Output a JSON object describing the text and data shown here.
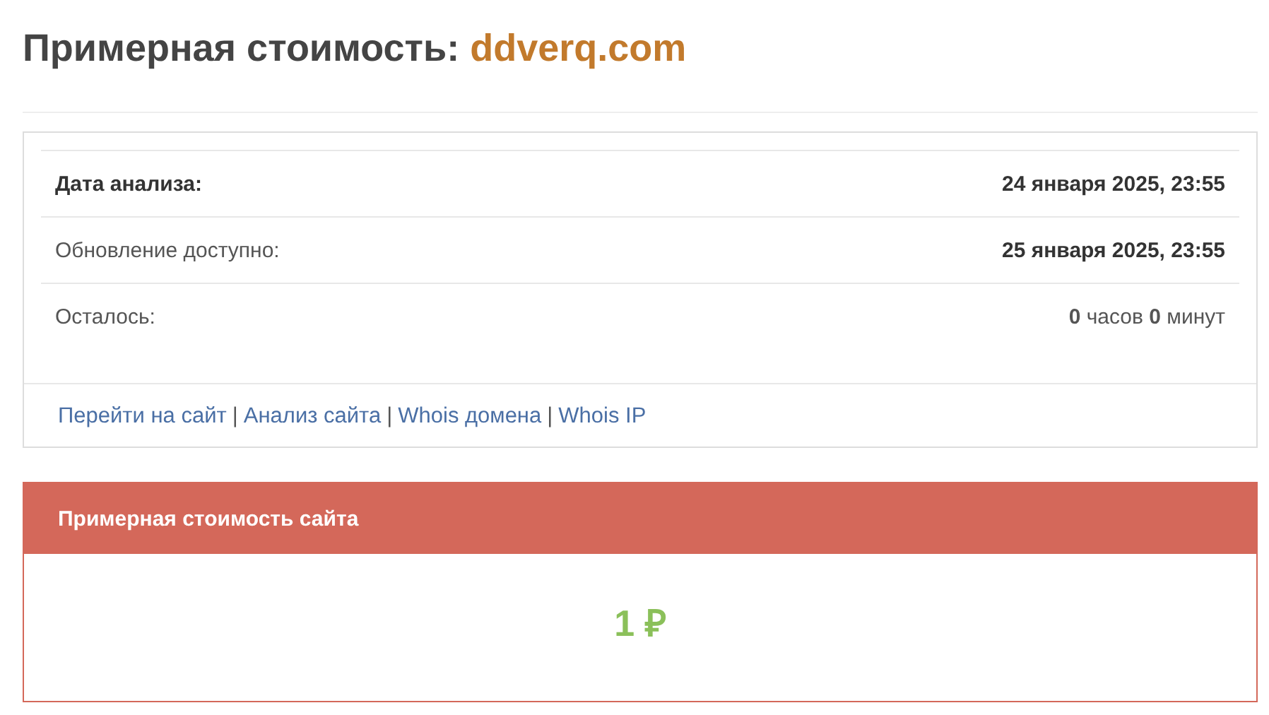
{
  "heading": {
    "label": "Примерная стоимость:",
    "domain": "ddverq.com"
  },
  "info_rows": [
    {
      "kind": "header",
      "label": "Дата анализа:",
      "value": "24 января 2025, 23:55"
    },
    {
      "kind": "date",
      "label": "Обновление доступно:",
      "value": "25 января 2025, 23:55"
    },
    {
      "kind": "countdown",
      "label": "Осталось:",
      "value": "**0** часов **0** минут"
    }
  ],
  "links": {
    "separator": "|",
    "items": [
      "Перейти на сайт",
      "Анализ сайта",
      "Whois домена",
      "Whois IP"
    ]
  },
  "value_panel": {
    "title": "Примерная стоимость сайта",
    "price": "1 ₽"
  }
}
